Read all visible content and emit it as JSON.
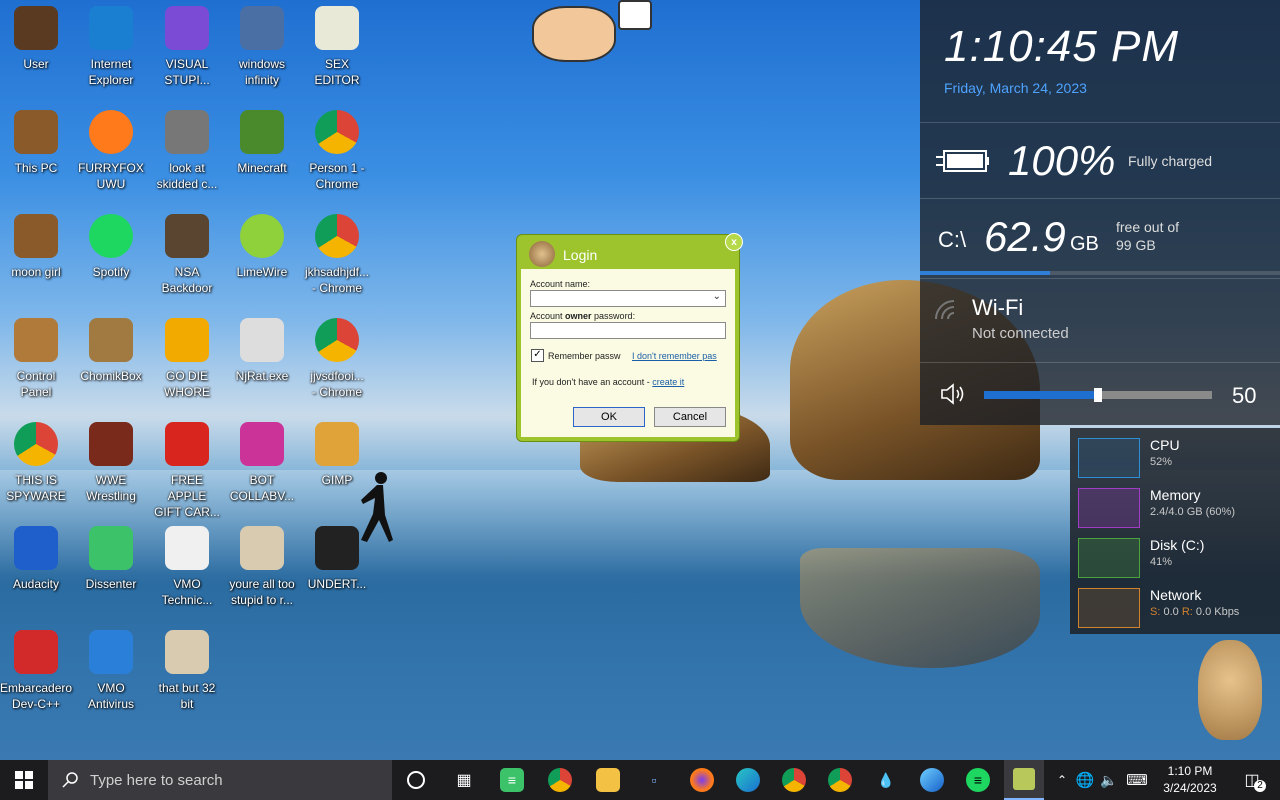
{
  "desktop": {
    "icons": [
      {
        "label": "User",
        "icon": "user-folder-icon"
      },
      {
        "label": "Internet\nExplorer",
        "icon": "edge-icon"
      },
      {
        "label": "VISUAL\nSTUPI...",
        "icon": "visual-studio-icon"
      },
      {
        "label": "windows\ninfinity",
        "icon": "virtualbox-icon"
      },
      {
        "label": "SEX\nEDITOR",
        "icon": "hex-editor-icon"
      },
      {
        "label": "This PC",
        "icon": "this-pc-icon"
      },
      {
        "label": "FURRYFOX\nUWU",
        "icon": "firefox-icon"
      },
      {
        "label": "look at\nskidded c...",
        "icon": "files-icon"
      },
      {
        "label": "Minecraft",
        "icon": "minecraft-icon"
      },
      {
        "label": "Person 1 -\nChrome",
        "icon": "chrome-icon"
      },
      {
        "label": "moon girl",
        "icon": "box-icon"
      },
      {
        "label": "Spotify",
        "icon": "spotify-icon"
      },
      {
        "label": "NSA\nBackdoor",
        "icon": "safe-icon"
      },
      {
        "label": "LimeWire",
        "icon": "limewire-icon"
      },
      {
        "label": "jkhsadhjdf...\n- Chrome",
        "icon": "chrome-icon"
      },
      {
        "label": "Control\nPanel",
        "icon": "control-panel-icon"
      },
      {
        "label": "ChomikBox",
        "icon": "hamster-box-icon"
      },
      {
        "label": "GO DIE\nWHORE",
        "icon": "de-icon"
      },
      {
        "label": "NjRat.exe",
        "icon": "skull-icon"
      },
      {
        "label": "jjvsdfooi...\n- Chrome",
        "icon": "chrome-icon"
      },
      {
        "label": "THIS IS\nSPYWARE",
        "icon": "chrome-icon"
      },
      {
        "label": "WWE\nWrestling",
        "icon": "wrestling-icon"
      },
      {
        "label": "FREE APPLE\nGIFT CAR...",
        "icon": "apple-icon"
      },
      {
        "label": "BOT\nCOLLABV...",
        "icon": "bot-icon"
      },
      {
        "label": "GIMP",
        "icon": "gimp-file-icon"
      },
      {
        "label": "Audacity",
        "icon": "audacity-icon"
      },
      {
        "label": "Dissenter",
        "icon": "dissenter-icon"
      },
      {
        "label": "VMO\nTechnic...",
        "icon": "technician-icon"
      },
      {
        "label": "youre all too\nstupid to r...",
        "icon": "portrait-icon"
      },
      {
        "label": "UNDERT...",
        "icon": "unity-icon"
      },
      {
        "label": "Embarcadero\nDev-C++",
        "icon": "devcpp-icon"
      },
      {
        "label": "VMO\nAntivirus",
        "icon": "shield-icon"
      },
      {
        "label": "that but 32\nbit",
        "icon": "portrait-icon"
      }
    ]
  },
  "sidebar": {
    "time": "1:10:45 PM",
    "date": "Friday, March 24, 2023",
    "battery": {
      "percent": "100%",
      "status": "Fully charged"
    },
    "disk": {
      "drive": "C:\\",
      "value": "62.9",
      "unit": "GB",
      "desc1": "free out of",
      "desc2": "99 GB",
      "used_fraction": 0.36
    },
    "wifi": {
      "name": "Wi-Fi",
      "status": "Not connected"
    },
    "volume": {
      "value": "50",
      "level": 0.5
    }
  },
  "perf": {
    "cpu": {
      "name": "CPU",
      "value": "52%",
      "color": "#2e8fd6"
    },
    "memory": {
      "name": "Memory",
      "value": "2.4/4.0 GB (60%)",
      "color": "#a23cc6"
    },
    "disk": {
      "name": "Disk (C:)",
      "value": "41%",
      "color": "#4ca53c"
    },
    "network": {
      "name": "Network",
      "s_label": "S:",
      "s_value": "0.0",
      "r_label": "R:",
      "r_value": "0.0 Kbps",
      "color": "#d1822d"
    }
  },
  "login": {
    "title": "Login",
    "account_label": "Account name:",
    "password_label_pre": "Account ",
    "password_label_bold": "owner",
    "password_label_post": " password:",
    "remember": "Remember passw",
    "forgot": "I don't remember pas",
    "no_account": "If you don't have an account - ",
    "create": "create it",
    "ok": "OK",
    "cancel": "Cancel",
    "close": "x"
  },
  "taskbar": {
    "search_placeholder": "Type here to search",
    "clock_time": "1:10 PM",
    "clock_date": "3/24/2023",
    "notif_count": "2"
  }
}
